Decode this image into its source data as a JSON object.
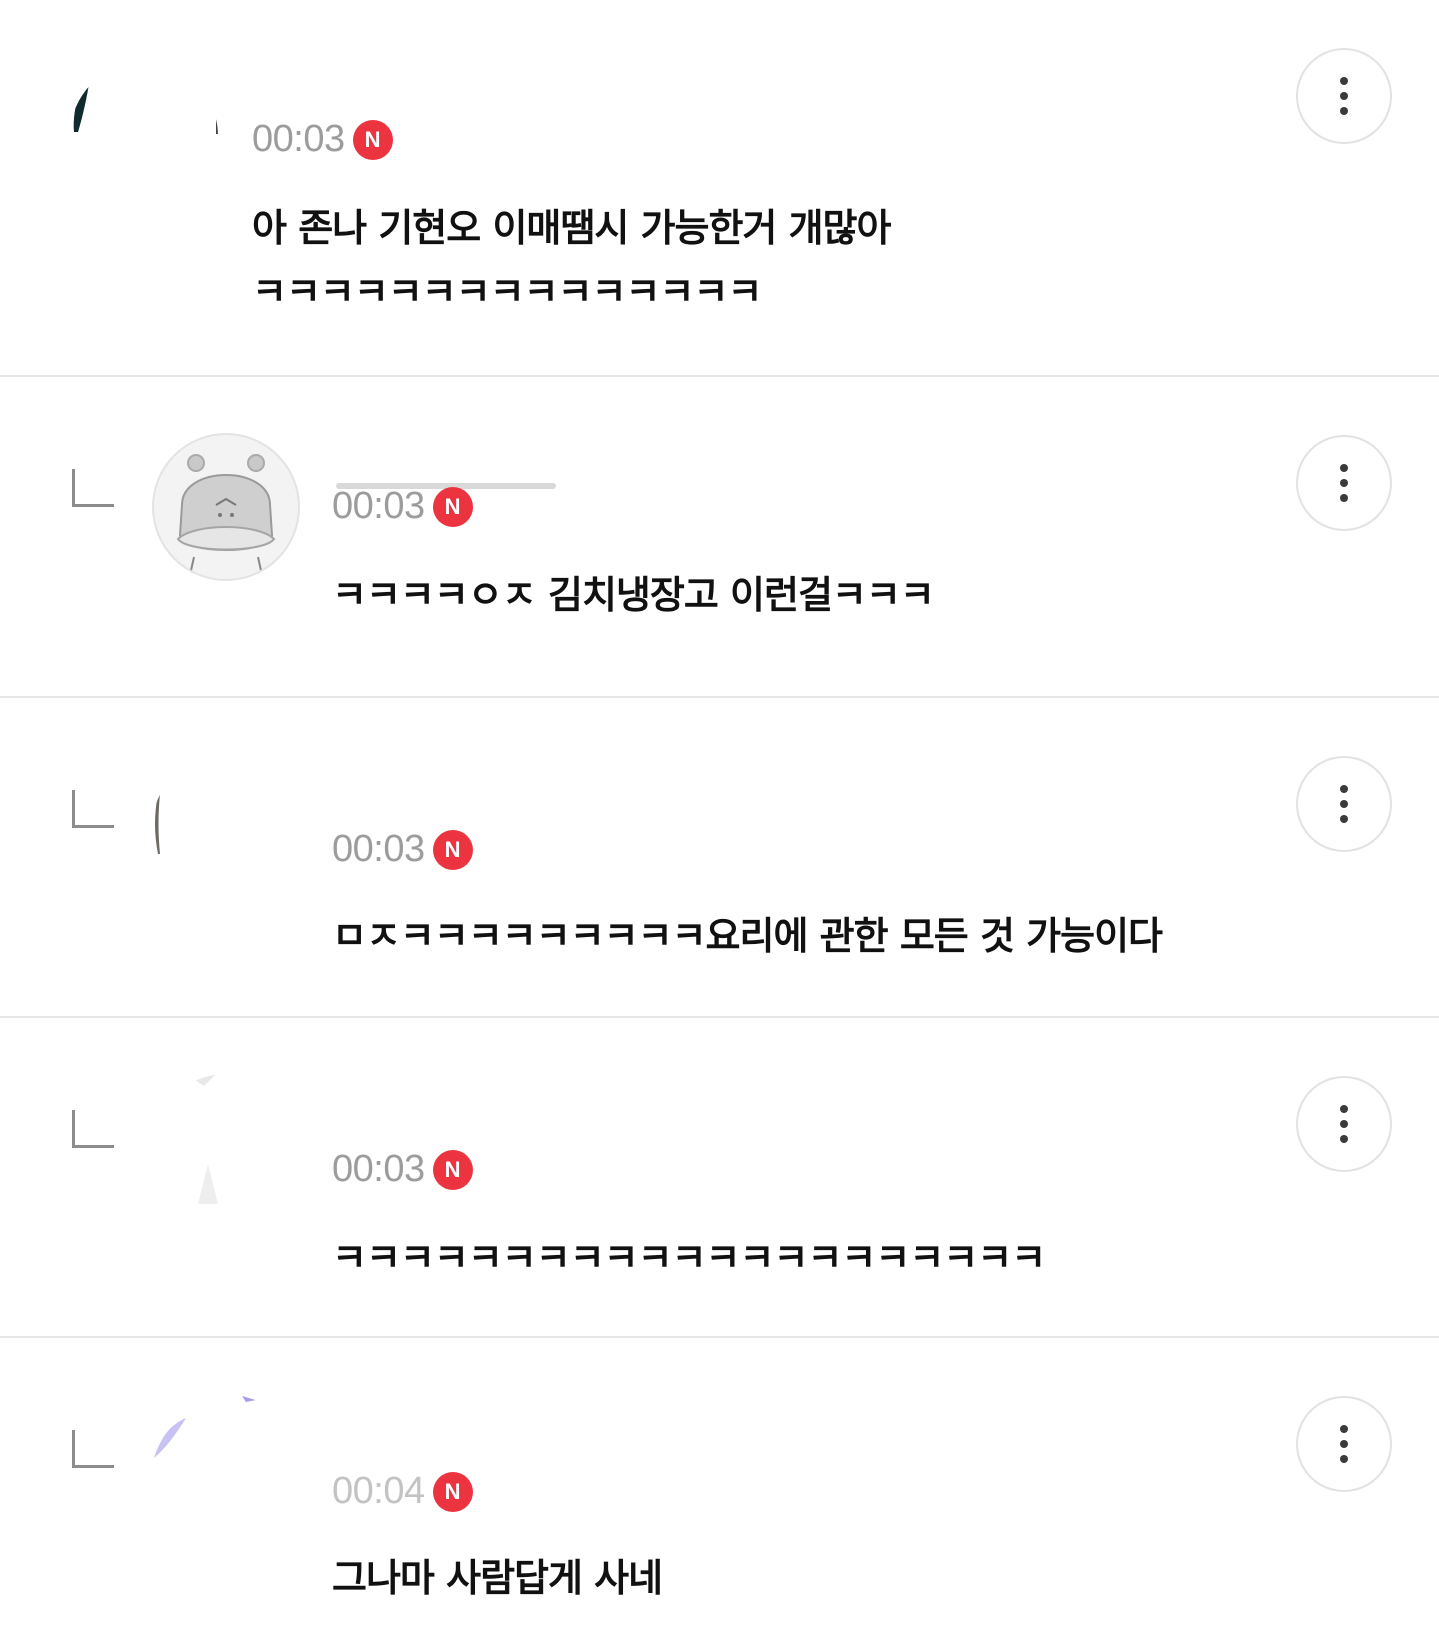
{
  "comments": [
    {
      "time": "00:03",
      "badge": "N",
      "text": "아 존나 기현오 이매땜시 가능한거 개많아\nㅋㅋㅋㅋㅋㅋㅋㅋㅋㅋㅋㅋㅋㅋㅋ",
      "more_icon": "more-vertical-icon"
    },
    {
      "time": "00:03",
      "badge": "N",
      "text": "ㅋㅋㅋㅋㅇㅈ 김치냉장고 이런걸ㅋㅋㅋ",
      "reply": true,
      "more_icon": "more-vertical-icon"
    },
    {
      "time": "00:03",
      "badge": "N",
      "text": "ㅁㅈㅋㅋㅋㅋㅋㅋㅋㅋㅋ요리에 관한 모든 것 가능이다",
      "reply": true,
      "more_icon": "more-vertical-icon"
    },
    {
      "time": "00:03",
      "badge": "N",
      "text": "ㅋㅋㅋㅋㅋㅋㅋㅋㅋㅋㅋㅋㅋㅋㅋㅋㅋㅋㅋㅋㅋ",
      "reply": true,
      "more_icon": "more-vertical-icon"
    },
    {
      "time": "00:04",
      "badge": "N",
      "text": "그나마 사람답게 사네",
      "reply": true,
      "more_icon": "more-vertical-icon"
    }
  ],
  "colors": {
    "badge": "#ec3440",
    "time": "#9c9c9c",
    "text": "#111111",
    "divider": "#e6e6e6"
  }
}
